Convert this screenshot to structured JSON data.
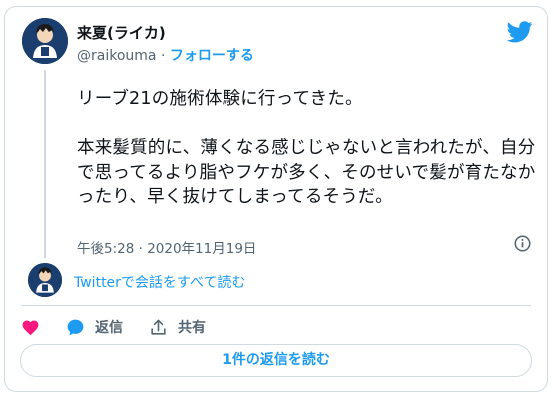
{
  "user": {
    "display_name": "来夏(ライカ)",
    "handle": "@raikouma",
    "separator": " · ",
    "follow_label": "フォローする"
  },
  "tweet": {
    "text": "リーブ21の施術体験に行ってきた。\n\n本来髪質的に、薄くなる感じじゃないと言われたが、自分で思ってるより脂やフケが多く、そのせいで髪が育たなかったり、早く抜けてしまってるそうだ。",
    "timestamp": "午後5:28 · 2020年11月19日"
  },
  "conversation": {
    "read_all_label": "Twitterで会話をすべて読む"
  },
  "actions": {
    "like_icon": "heart-icon",
    "reply_label": "返信",
    "share_label": "共有"
  },
  "replies_button": {
    "label": "1件の返信を読む"
  },
  "colors": {
    "accent": "#1d9bf0",
    "like": "#f91880",
    "muted": "#536471",
    "border": "#cfd9de"
  }
}
